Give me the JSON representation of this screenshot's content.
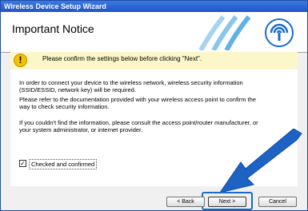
{
  "window": {
    "title": "Wireless Device Setup Wizard"
  },
  "header": {
    "title": "Important Notice",
    "logo_icon": "wireless-waves-logo-icon"
  },
  "notice": {
    "text": "Please confirm the settings below before clicking \"Next\".",
    "icon": "exclamation-warning-icon"
  },
  "body": {
    "para1_line1": "In order to connect your device to the wireless network,  wireless security information",
    "para1_line2": "(SSID/ESSID, network key) will be required.",
    "para2_line1": "Please refer to the documentation provided with your wireless access point to confirm the",
    "para2_line2": "way to check security information.",
    "para3_line1": "If you couldn't find the information, please consult the access point/router manufacturer, or",
    "para3_line2": "your system administrator, or internet provider."
  },
  "checkbox": {
    "label": "Checked and confirmed",
    "checked": "✓"
  },
  "buttons": {
    "back": "< Back",
    "next": "Next >",
    "cancel": "Cancel"
  },
  "colors": {
    "titlebar": "#2a62d0",
    "highlight": "#1a6bc9",
    "arrow": "#1e63c4"
  }
}
